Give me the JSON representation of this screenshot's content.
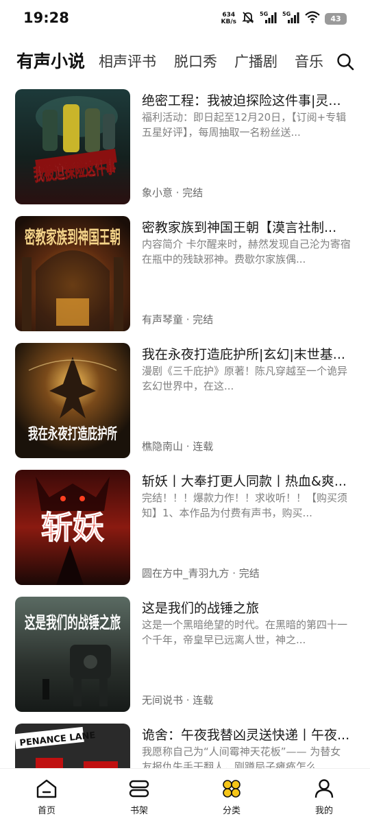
{
  "status_bar": {
    "time": "19:28",
    "net_speed_value": "634",
    "net_speed_unit": "KB/s",
    "signal1_label": "5G",
    "signal2_label": "5G",
    "battery": "43"
  },
  "tabs": [
    {
      "label": "有声小说",
      "active": true
    },
    {
      "label": "相声评书",
      "active": false
    },
    {
      "label": "脱口秀",
      "active": false
    },
    {
      "label": "广播剧",
      "active": false
    },
    {
      "label": "音乐",
      "active": false
    }
  ],
  "books": [
    {
      "title": "绝密工程：我被迫探险这件事|灵...",
      "description": "福利活动：即日起至12月20日，【订阅+专辑五星好评】，每周抽取一名粉丝送...",
      "meta": "象小意 · 完结",
      "cover_text": "我被迫探险这件事"
    },
    {
      "title": "密教家族到神国王朝【漠言社制...",
      "description": "内容简介 卡尔醒来时，赫然发现自己沦为寄宿在瓶中的残缺邪神。费歇尔家族偶...",
      "meta": "有声琴童 · 完结",
      "cover_text": "密教家族到神国王朝"
    },
    {
      "title": "我在永夜打造庇护所|玄幻|末世基...",
      "description": "漫剧《三千庇护》原著！陈凡穿越至一个诡异玄幻世界中，在这...",
      "meta": "樵隐南山 · 连载",
      "cover_text": "我在永夜打造庇护所"
    },
    {
      "title": "斩妖丨大奉打更人同款丨热血&爽...",
      "description": "完结！！！爆款力作！！求收听！！【购买须知】1、本作品为付费有声书，购买...",
      "meta": "圆在方中_青羽九方 · 完结",
      "cover_text": "斩妖"
    },
    {
      "title": "这是我们的战锤之旅",
      "description": "这是一个黑暗绝望的时代。在黑暗的第四十一个千年，帝皇早已远离人世，神之...",
      "meta": "无间说书 · 连载",
      "cover_text": "这是我们的战锤之旅"
    },
    {
      "title": "诡舍：午夜我替凶灵送快递丨午夜...",
      "description": "我愿称自己为“人间霉神天花板”—— 为替女友报仇失手干翻人，刚蹲局子瘫痪怎么...",
      "meta": "",
      "cover_text": "PENANCE LANE"
    }
  ],
  "bottom_nav": [
    {
      "label": "首页",
      "icon": "home-icon"
    },
    {
      "label": "书架",
      "icon": "bookshelf-icon"
    },
    {
      "label": "分类",
      "icon": "category-icon",
      "active_color": "#f5c518"
    },
    {
      "label": "我的",
      "icon": "profile-icon"
    }
  ]
}
